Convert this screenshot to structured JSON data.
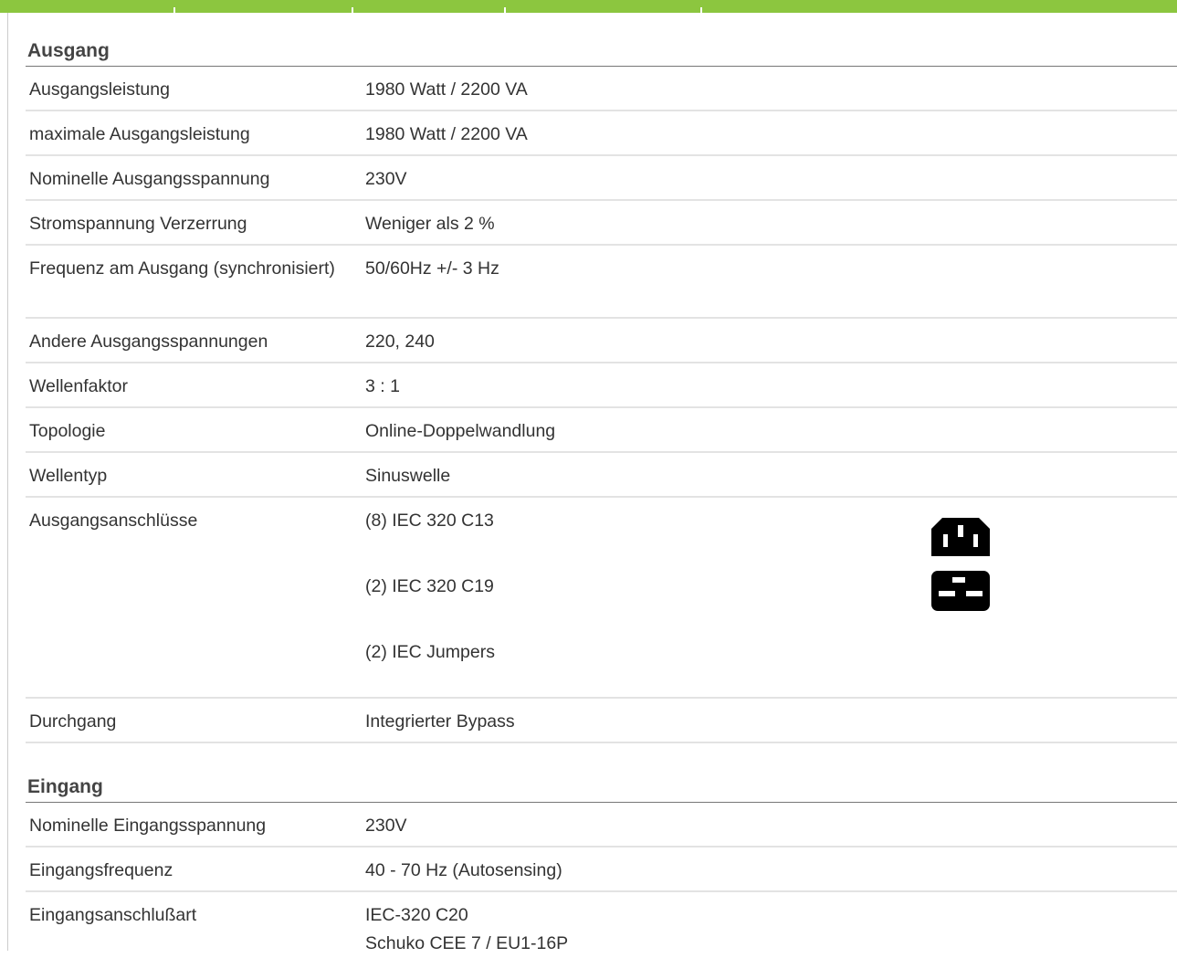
{
  "colors": {
    "accent_bar": "#8cc63f",
    "row_divider": "#e3e3e3",
    "section_rule": "#777777"
  },
  "ausgang": {
    "title": "Ausgang",
    "rows": [
      {
        "label": "Ausgangsleistung",
        "value": "1980 Watt / 2200 VA"
      },
      {
        "label": "maximale Ausgangsleistung",
        "value": "1980 Watt / 2200 VA"
      },
      {
        "label": "Nominelle Ausgangsspannung",
        "value": "230V"
      },
      {
        "label": "Stromspannung Verzerrung",
        "value": "Weniger als 2 %"
      },
      {
        "label": "Frequenz am Ausgang (synchronisiert)",
        "value": "50/60Hz +/- 3 Hz"
      },
      {
        "label": "Andere Ausgangsspannungen",
        "value": "220, 240"
      },
      {
        "label": "Wellenfaktor",
        "value": "3 : 1"
      },
      {
        "label": "Topologie",
        "value": "Online-Doppelwandlung"
      },
      {
        "label": "Wellentyp",
        "value": "Sinuswelle"
      }
    ],
    "connections": {
      "label": "Ausgangsanschlüsse",
      "items": [
        {
          "text": "(8) IEC 320 C13",
          "icon": "iec-c13-outlet-icon"
        },
        {
          "text": "(2) IEC 320 C19",
          "icon": "iec-c19-outlet-icon"
        },
        {
          "text": "(2) IEC Jumpers",
          "icon": ""
        }
      ]
    },
    "bypass": {
      "label": "Durchgang",
      "value": "Integrierter Bypass"
    }
  },
  "eingang": {
    "title": "Eingang",
    "rows": [
      {
        "label": "Nominelle Eingangsspannung",
        "value": "230V"
      },
      {
        "label": "Eingangsfrequenz",
        "value": "40 - 70 Hz (Autosensing)"
      }
    ],
    "connector": {
      "label": "Eingangsanschlußart",
      "values": [
        "IEC-320 C20",
        "Schuko CEE 7 / EU1-16P"
      ]
    }
  }
}
